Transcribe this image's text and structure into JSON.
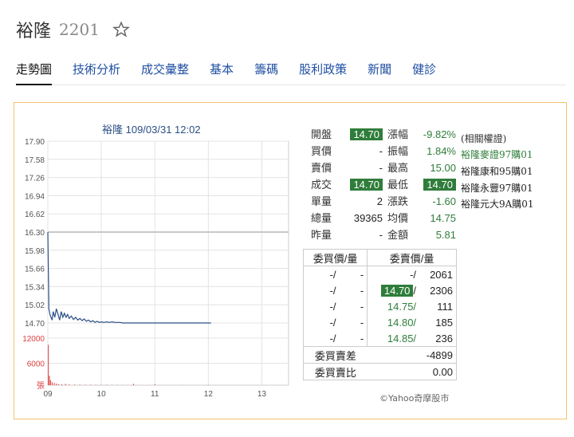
{
  "stock": {
    "name": "裕隆",
    "code": "2201"
  },
  "tabs": [
    {
      "label": "走勢圖",
      "active": true
    },
    {
      "label": "技術分析"
    },
    {
      "label": "成交彙整"
    },
    {
      "label": "基本"
    },
    {
      "label": "籌碼"
    },
    {
      "label": "股利政策"
    },
    {
      "label": "新聞"
    },
    {
      "label": "健診"
    }
  ],
  "chart_data": {
    "type": "line",
    "title": "裕隆 109/03/31 12:02",
    "y_ticks": [
      "17.90",
      "17.58",
      "17.26",
      "16.94",
      "16.62",
      "16.30",
      "15.98",
      "15.66",
      "15.34",
      "15.02",
      "14.70"
    ],
    "ylim": [
      14.7,
      17.9
    ],
    "reference_price": 16.3,
    "x_ticks": [
      "09",
      "10",
      "11",
      "12",
      "13"
    ],
    "volume_ticks": [
      "12000",
      "6000",
      "張"
    ],
    "price_series": [
      [
        9.0,
        16.3
      ],
      [
        9.02,
        14.95
      ],
      [
        9.04,
        14.85
      ],
      [
        9.06,
        14.8
      ],
      [
        9.08,
        14.75
      ],
      [
        9.1,
        14.9
      ],
      [
        9.13,
        14.8
      ],
      [
        9.16,
        14.95
      ],
      [
        9.19,
        14.85
      ],
      [
        9.22,
        14.75
      ],
      [
        9.25,
        14.9
      ],
      [
        9.28,
        14.8
      ],
      [
        9.31,
        14.87
      ],
      [
        9.34,
        14.8
      ],
      [
        9.37,
        14.85
      ],
      [
        9.4,
        14.78
      ],
      [
        9.44,
        14.82
      ],
      [
        9.48,
        14.76
      ],
      [
        9.52,
        14.8
      ],
      [
        9.56,
        14.75
      ],
      [
        9.6,
        14.78
      ],
      [
        9.64,
        14.74
      ],
      [
        9.68,
        14.77
      ],
      [
        9.72,
        14.73
      ],
      [
        9.76,
        14.75
      ],
      [
        9.8,
        14.72
      ],
      [
        9.84,
        14.74
      ],
      [
        9.88,
        14.71
      ],
      [
        9.92,
        14.73
      ],
      [
        9.96,
        14.71
      ],
      [
        10.0,
        14.72
      ],
      [
        10.05,
        14.71
      ],
      [
        10.1,
        14.72
      ],
      [
        10.15,
        14.71
      ],
      [
        10.2,
        14.72
      ],
      [
        10.25,
        14.71
      ],
      [
        10.3,
        14.71
      ],
      [
        10.35,
        14.71
      ],
      [
        10.4,
        14.7
      ],
      [
        11.0,
        14.7
      ],
      [
        12.05,
        14.7
      ]
    ],
    "volume_series": [
      [
        9.01,
        12000
      ],
      [
        9.03,
        2800
      ],
      [
        9.05,
        1500
      ],
      [
        9.08,
        900
      ],
      [
        9.12,
        700
      ],
      [
        9.16,
        500
      ],
      [
        9.2,
        300
      ],
      [
        9.26,
        250
      ],
      [
        9.33,
        400
      ],
      [
        9.4,
        200
      ],
      [
        9.5,
        180
      ],
      [
        9.6,
        150
      ],
      [
        9.7,
        120
      ],
      [
        9.8,
        140
      ],
      [
        9.9,
        100
      ],
      [
        10.0,
        90
      ],
      [
        10.1,
        80
      ],
      [
        10.2,
        70
      ],
      [
        10.3,
        60
      ],
      [
        10.4,
        60
      ],
      [
        10.6,
        400
      ],
      [
        11.0,
        300
      ],
      [
        11.5,
        60
      ],
      [
        12.0,
        80
      ]
    ]
  },
  "quote": {
    "rows": [
      {
        "l1": "開盤",
        "v1": "14.70",
        "h1": true,
        "l2": "漲幅",
        "v2": "-9.82%",
        "g2": true
      },
      {
        "l1": "買價",
        "v1": "-",
        "l2": "振幅",
        "v2": "1.84%",
        "g2": true
      },
      {
        "l1": "賣價",
        "v1": "-",
        "l2": "最高",
        "v2": "15.00",
        "g2": true
      },
      {
        "l1": "成交",
        "v1": "14.70",
        "h1": true,
        "l2": "最低",
        "v2": "14.70",
        "h2": true
      },
      {
        "l1": "單量",
        "v1": "2",
        "l2": "漲跌",
        "v2": "-1.60",
        "g2": true
      },
      {
        "l1": "總量",
        "v1": "39365",
        "l2": "均價",
        "v2": "14.75",
        "g2": true
      },
      {
        "l1": "昨量",
        "v1": "-",
        "l2": "金額",
        "v2": "5.81",
        "g2": true
      }
    ]
  },
  "warrants": {
    "header": "(相關權證)",
    "items": [
      "裕隆麥證97購01",
      "裕隆康和95購01",
      "裕隆永豐97購01",
      "裕隆元大9A購01"
    ]
  },
  "orderbook": {
    "bid_header": "委買價/量",
    "ask_header": "委賣價/量",
    "rows": [
      {
        "bid": "-/",
        "bid_vol": "-",
        "ask_price": "-",
        "ask_vol": "2061",
        "ask_hl": false
      },
      {
        "bid": "-/",
        "bid_vol": "-",
        "ask_price": "14.70",
        "ask_vol": "2306",
        "ask_hl": true
      },
      {
        "bid": "-/",
        "bid_vol": "-",
        "ask_price": "14.75",
        "ask_vol": "111",
        "ask_hl": false
      },
      {
        "bid": "-/",
        "bid_vol": "-",
        "ask_price": "14.80",
        "ask_vol": "185",
        "ask_hl": false
      },
      {
        "bid": "-/",
        "bid_vol": "-",
        "ask_price": "14.85",
        "ask_vol": "236",
        "ask_hl": false
      }
    ],
    "diff_label": "委買賣差",
    "diff_value": "-4899",
    "ratio_label": "委買賣比",
    "ratio_value": "0.00"
  },
  "copyright": "©Yahoo奇摩股市",
  "colors": {
    "price_line": "#2a4f86",
    "volume": "#e04040",
    "reference": "#c8c8c8",
    "highlight": "#2f7d3a",
    "tab_link": "#1f4fa3"
  }
}
